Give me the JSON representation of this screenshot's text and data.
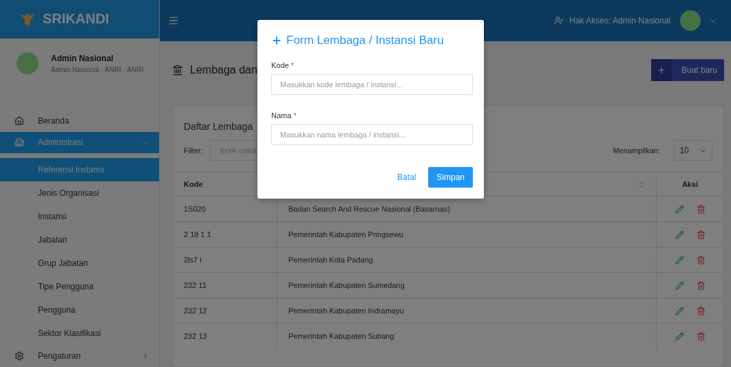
{
  "brand": "SRIKANDI",
  "header": {
    "access_label": "Hak Akses: Admin Nasional"
  },
  "profile": {
    "name": "Admin Nasional",
    "subtitle": "Admin Nasional - ANRI - ANRI"
  },
  "sidebar": {
    "items": [
      {
        "label": "Beranda",
        "selected": false
      },
      {
        "label": "Administrasi",
        "selected": true,
        "expanded": true,
        "children": [
          {
            "label": "Referensi Instansi",
            "selected": true
          },
          {
            "label": "Jenis Organisasi",
            "selected": false
          },
          {
            "label": "Instansi",
            "selected": false
          },
          {
            "label": "Jabatan",
            "selected": false
          },
          {
            "label": "Grup Jabatan",
            "selected": false
          },
          {
            "label": "Tipe Pengguna",
            "selected": false
          },
          {
            "label": "Pengguna",
            "selected": false
          },
          {
            "label": "Sektor Klasifikasi",
            "selected": false
          }
        ]
      },
      {
        "label": "Pengaturan",
        "selected": false,
        "expanded": false
      }
    ]
  },
  "page": {
    "title": "Lembaga dan",
    "create_button": "Buat baru"
  },
  "card": {
    "title": "Daftar Lembaga",
    "filter_label": "Filter:",
    "filter_placeholder": "Ketik untuk",
    "show_label": "Menampilkan:",
    "page_size": "10"
  },
  "table": {
    "columns": [
      {
        "label": "Kode",
        "sortable": false
      },
      {
        "sortable": true
      },
      {
        "label": "Aksi",
        "sortable": false
      }
    ],
    "rows": [
      {
        "code": "1S020",
        "name": "Badan Search And Rescue Nasional (Basarnas)"
      },
      {
        "code": "2 18 1 1",
        "name": "Pemerintah Kabupaten Pringsewu"
      },
      {
        "code": "2ls7 i",
        "name": "Pemerintah Kota Padang"
      },
      {
        "code": "232 11",
        "name": "Pemerintah Kabupaten Sumedang"
      },
      {
        "code": "232 12",
        "name": "Pemerintah Kabupaten Indramayu"
      },
      {
        "code": "232 13",
        "name": "Pemerintah Kabupaten Subang"
      }
    ]
  },
  "modal": {
    "title": "Form Lembaga / Instansi Baru",
    "fields": [
      {
        "label": "Kode",
        "required_mark": "*",
        "placeholder": "Masukkan kode lembaga / instansi..."
      },
      {
        "label": "Nama",
        "required_mark": "*",
        "placeholder": "Masukkan nama lembaga / instansi..."
      }
    ],
    "cancel": "Batal",
    "save": "Simpan"
  }
}
